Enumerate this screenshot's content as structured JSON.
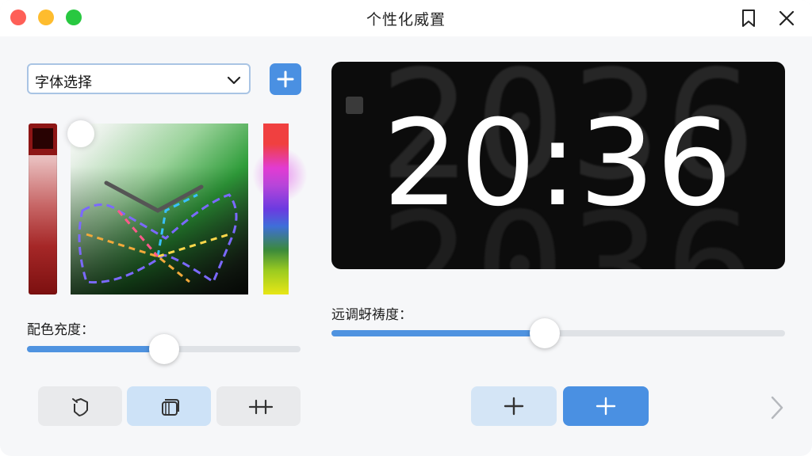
{
  "window": {
    "title": "个性化威置"
  },
  "left_panel": {
    "font_select": {
      "value": "字体选择"
    },
    "color_label": "配色充度：",
    "color_slider_value": 0.5
  },
  "right_panel": {
    "clock_time": "20:36",
    "ghost_digits_top": "2036",
    "ghost_digits_bottom": "2036",
    "brightness_label": "远调蚜祷度：",
    "brightness_slider_value": 0.47
  },
  "icons": {
    "close": "close-icon",
    "bookmark": "bookmark-icon",
    "add": "plus-icon",
    "chevron_down": "chevron-down-icon",
    "chevron_right": "chevron-right-icon"
  },
  "colors": {
    "accent": "#4a90e2",
    "accent_light": "#cde2f7",
    "clock_bg": "#0c0c0c"
  }
}
